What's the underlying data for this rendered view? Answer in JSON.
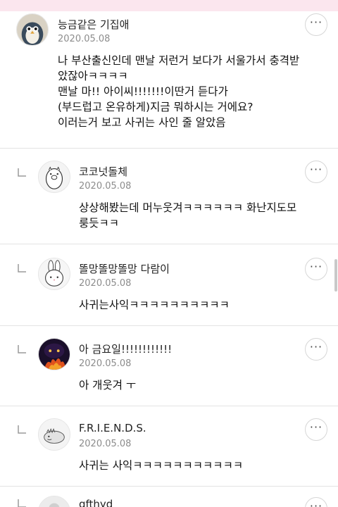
{
  "comments": [
    {
      "author": "능금같은 기집애",
      "date": "2020.05.08",
      "avatar_icon": "penguin-avatar-icon",
      "lines": [
        "나 부산출신인데 맨날 저런거 보다가 서울가서 충격받",
        "았잖아ㅋㅋㅋㅋ",
        "맨날 마!! 아이씨!!!!!!!이딴거 듣다가",
        "(부드럽고 온유하게)지금 뭐하시는 거에요?",
        "이러는거 보고 사귀는 사인 줄 알았음"
      ]
    },
    {
      "author": "코코넛돌체",
      "date": "2020.05.08",
      "avatar_icon": "pig-character-avatar-icon",
      "lines": [
        "상상해봤는데 머누웃겨ㅋㅋㅋㅋㅋㅋ 화난지도모",
        "룽듯ㅋㅋ"
      ]
    },
    {
      "author": "똘망똘망똘망 다람이",
      "date": "2020.05.08",
      "avatar_icon": "bunny-avatar-icon",
      "lines": [
        "사귀는사익ㅋㅋㅋㅋㅋㅋㅋㅋㅋㅋ"
      ]
    },
    {
      "author": "아 금요일!!!!!!!!!!!!",
      "date": "2020.05.08",
      "avatar_icon": "dark-fire-avatar-icon",
      "lines": [
        "아 개웃겨 ㅜ"
      ]
    },
    {
      "author": "F.R.I.E.N.D.S.",
      "date": "2020.05.08",
      "avatar_icon": "dinosaur-avatar-icon",
      "lines": [
        "사귀는 사익ㅋㅋㅋㅋㅋㅋㅋㅋㅋㅋㅋ"
      ]
    },
    {
      "author": "gfthyd",
      "date": "",
      "avatar_icon": "default-avatar-icon",
      "lines": []
    }
  ],
  "more_button_label": "···",
  "colors": {
    "top_bar": "#fbe6ee",
    "divider": "#e3e3e3",
    "date_text": "#8c8c8c"
  }
}
